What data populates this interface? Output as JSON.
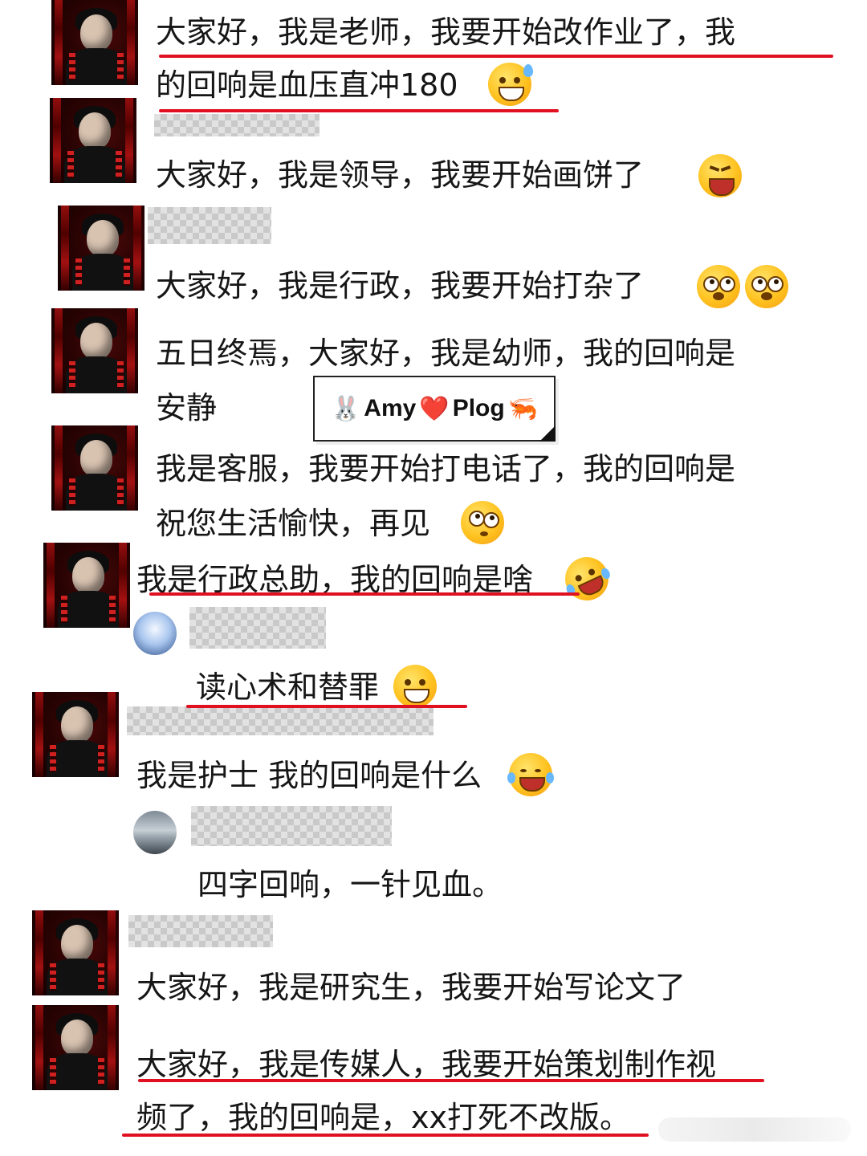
{
  "comments": [
    {
      "id": "c1",
      "lines": [
        "大家好，我是老师，我要开始改作业了，我",
        "的回响是血压直冲180"
      ]
    },
    {
      "id": "c2",
      "lines": [
        "大家好，我是领导，我要开始画饼了"
      ]
    },
    {
      "id": "c3",
      "lines": [
        "大家好，我是行政，我要开始打杂了"
      ]
    },
    {
      "id": "c4",
      "lines": [
        "五日终焉，大家好，我是幼师，我的回响是",
        "安静"
      ]
    },
    {
      "id": "c5",
      "lines": [
        "我是客服，我要开始打电话了，我的回响是",
        "祝您生活愉快，再见"
      ]
    },
    {
      "id": "c6",
      "lines": [
        "我是行政总助，我的回响是啥"
      ]
    },
    {
      "id": "r1",
      "lines": [
        "读心术和替罪"
      ]
    },
    {
      "id": "c7",
      "lines": [
        "我是护士 我的回响是什么"
      ]
    },
    {
      "id": "r2",
      "lines": [
        "四字回响，一针见血。"
      ]
    },
    {
      "id": "c8",
      "lines": [
        "大家好，我是研究生，我要开始写论文了"
      ]
    },
    {
      "id": "c9",
      "lines": [
        "大家好，我是传媒人，我要开始策划制作视",
        "频了，我的回响是，xx打死不改版。"
      ]
    }
  ],
  "watermark": {
    "left": "🐰",
    "name": "Amy",
    "heart": "❤️",
    "right": "Plog",
    "tail": "🦐"
  },
  "icons": {
    "avatar": "red-portrait-avatar",
    "emoji": "emoji-face",
    "reply_avatar": "round-user-avatar"
  },
  "colors": {
    "underline": "#e01020",
    "mask": "#cfcfcf",
    "text": "#161616"
  }
}
